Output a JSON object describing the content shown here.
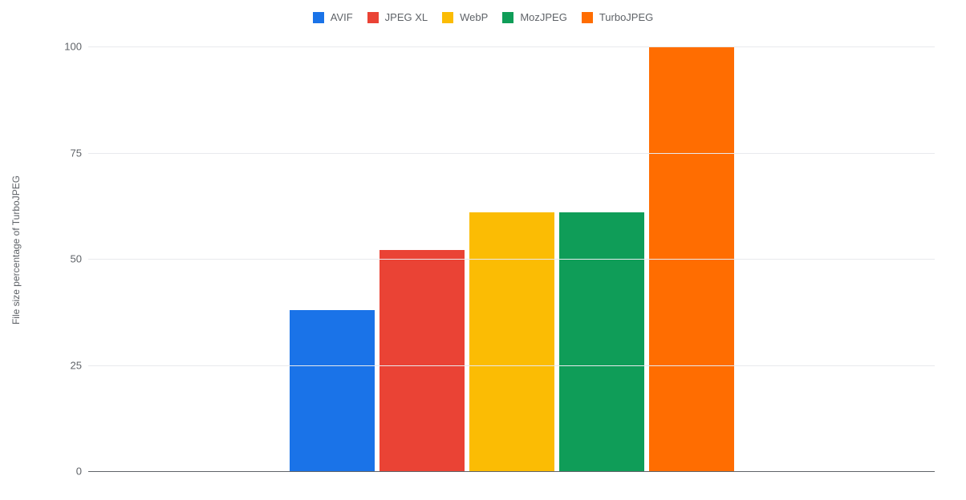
{
  "chart_data": {
    "type": "bar",
    "categories": [
      "AVIF",
      "JPEG XL",
      "WebP",
      "MozJPEG",
      "TurboJPEG"
    ],
    "values": [
      38,
      52,
      61,
      61,
      100
    ],
    "colors": [
      "#1a73e8",
      "#ea4335",
      "#fbbc04",
      "#0f9d58",
      "#ff6d01"
    ],
    "title": "",
    "xlabel": "",
    "ylabel": "File size percentage of TurboJPEG",
    "ylim": [
      0,
      100
    ],
    "yticks": [
      0,
      25,
      50,
      75,
      100
    ]
  }
}
